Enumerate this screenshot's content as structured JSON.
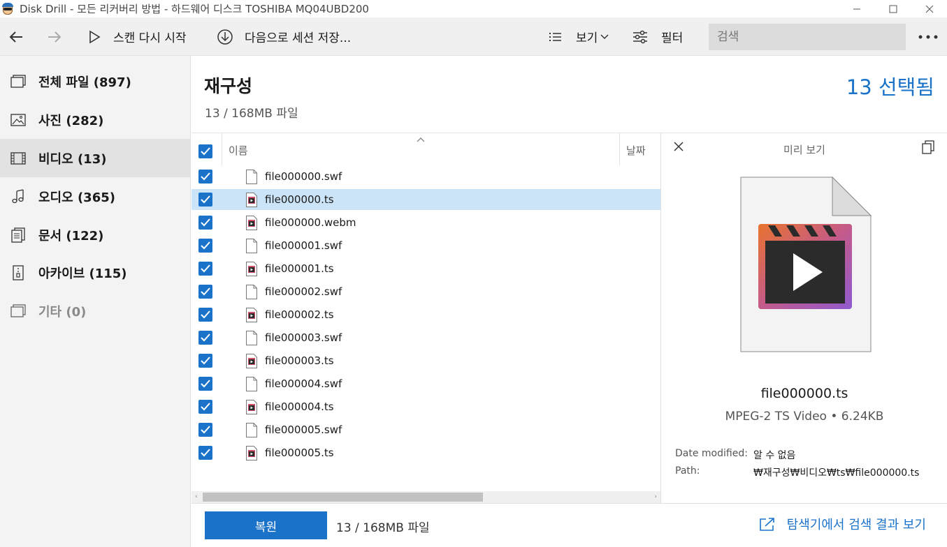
{
  "window": {
    "title": "Disk Drill - 모든 리커버리 방법 - 하드웨어 디스크 TOSHIBA MQ04UBD200",
    "minimize_icon": "minimize-icon",
    "maximize_icon": "maximize-icon",
    "close_icon": "close-icon"
  },
  "toolbar": {
    "back_icon": "arrow-left-icon",
    "forward_icon": "arrow-right-icon",
    "rescan_label": "스캔 다시 시작",
    "save_session_label": "다음으로 세션 저장...",
    "view_label": "보기",
    "filter_label": "필터",
    "search_placeholder": "검색",
    "more_icon": "more-icon"
  },
  "sidebar": {
    "items": [
      {
        "label": "전체 파일 (897)",
        "icon": "all-files-icon"
      },
      {
        "label": "사진 (282)",
        "icon": "photo-icon"
      },
      {
        "label": "비디오 (13)",
        "icon": "video-icon",
        "active": true
      },
      {
        "label": "오디오 (365)",
        "icon": "music-icon"
      },
      {
        "label": "문서 (122)",
        "icon": "document-icon"
      },
      {
        "label": "아카이브 (115)",
        "icon": "archive-icon"
      },
      {
        "label": "기타 (0)",
        "icon": "other-icon",
        "muted": true
      }
    ]
  },
  "main": {
    "title": "재구성",
    "subtitle": "13 / 168MB 파일",
    "selected_count": "13 선택됨"
  },
  "table": {
    "columns": {
      "name": "이름",
      "date": "날짜"
    },
    "rows": [
      {
        "name": "file000000.swf",
        "type": "swf"
      },
      {
        "name": "file000000.ts",
        "type": "ts",
        "selected": true
      },
      {
        "name": "file000000.webm",
        "type": "ts"
      },
      {
        "name": "file000001.swf",
        "type": "swf"
      },
      {
        "name": "file000001.ts",
        "type": "ts"
      },
      {
        "name": "file000002.swf",
        "type": "swf"
      },
      {
        "name": "file000002.ts",
        "type": "ts"
      },
      {
        "name": "file000003.swf",
        "type": "swf"
      },
      {
        "name": "file000003.ts",
        "type": "ts"
      },
      {
        "name": "file000004.swf",
        "type": "swf"
      },
      {
        "name": "file000004.ts",
        "type": "ts"
      },
      {
        "name": "file000005.swf",
        "type": "swf"
      },
      {
        "name": "file000005.ts",
        "type": "ts"
      }
    ]
  },
  "preview": {
    "title": "미리 보기",
    "file_name": "file000000.ts",
    "file_meta": "MPEG-2 TS Video • 6.24KB",
    "date_label": "Date modified:",
    "date_value": "알 수 없음",
    "path_label": "Path:",
    "path_value": "₩재구성₩비디오₩ts₩file000000.ts"
  },
  "bottom": {
    "recover_label": "복원",
    "summary": "13 / 168MB 파일",
    "explorer_link": "탐색기에서 검색 결과 보기"
  },
  "colors": {
    "accent": "#1a73c9",
    "selected_row": "#cce4f7",
    "sidebar_bg": "#f3f3f3",
    "toolbar_bg": "#f0f0f0"
  }
}
